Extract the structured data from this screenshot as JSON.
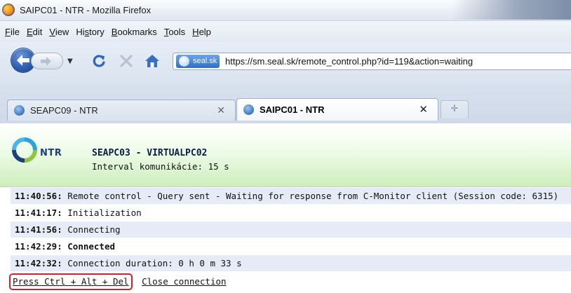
{
  "window": {
    "title": "SAIPC01 - NTR - Mozilla Firefox"
  },
  "menu": [
    {
      "label": "File",
      "accel_index": 0
    },
    {
      "label": "Edit",
      "accel_index": 0
    },
    {
      "label": "View",
      "accel_index": 0
    },
    {
      "label": "History",
      "accel_index": 2
    },
    {
      "label": "Bookmarks",
      "accel_index": 0
    },
    {
      "label": "Tools",
      "accel_index": 0
    },
    {
      "label": "Help",
      "accel_index": 0
    }
  ],
  "nav": {
    "site_identity": "seal.sk",
    "url": "https://sm.seal.sk/remote_control.php?id=119&action=waiting"
  },
  "tabs": [
    {
      "label": "SEAPC09 - NTR",
      "active": false
    },
    {
      "label": "SAIPC01 - NTR",
      "active": true
    }
  ],
  "icons": {
    "back": "back-arrow-icon",
    "forward": "forward-arrow-icon",
    "reload": "reload-icon",
    "stop": "stop-icon",
    "home": "home-icon",
    "close": "close-icon",
    "new_tab": "plus-icon"
  },
  "header": {
    "logo": "NTR",
    "pc_name": "SEAPC03 - VIRTUALPC02",
    "interval": "Interval komunikácie: 15 s"
  },
  "log": [
    {
      "time": "11:40:56:",
      "message": "Remote control - Query sent - Waiting for response from C-Monitor client (Session code: 6315)",
      "bold": false
    },
    {
      "time": "11:41:17:",
      "message": "Initialization",
      "bold": false
    },
    {
      "time": "11:41:56:",
      "message": "Connecting",
      "bold": false
    },
    {
      "time": "11:42:29:",
      "message": "Connected",
      "bold": true
    },
    {
      "time": "11:42:32:",
      "message": "Connection duration: 0 h 0 m 33 s",
      "bold": false
    }
  ],
  "actions": {
    "ctrl_alt_del": "Press Ctrl + Alt + Del",
    "close_connection": "Close connection"
  },
  "colors": {
    "highlight_border": "#d2202b",
    "log_row_shade": "#e6ebf7",
    "header_green": "#cdeebc"
  }
}
